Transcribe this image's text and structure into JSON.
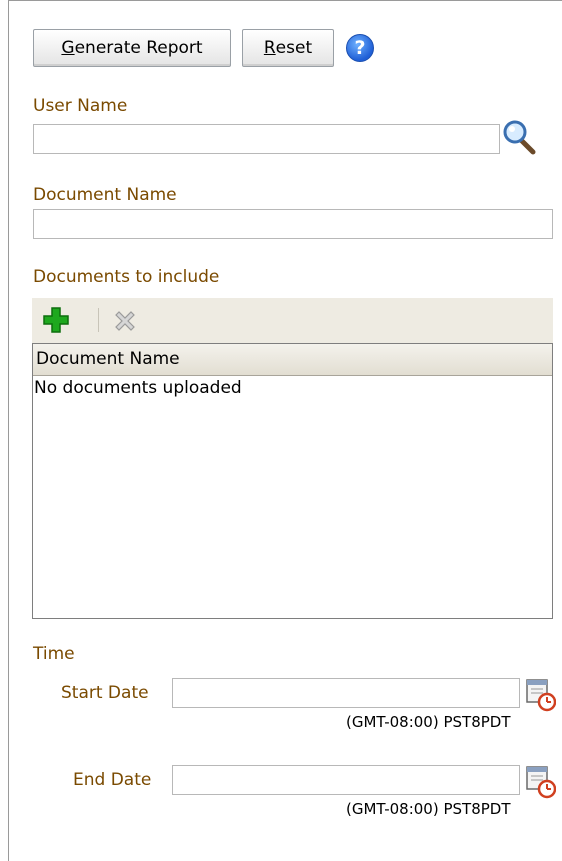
{
  "toolbar": {
    "generate_button_access": "G",
    "generate_button_rest": "enerate Report",
    "reset_button_access": "R",
    "reset_button_rest": "eset",
    "help_glyph": "?"
  },
  "fields": {
    "user_name_label": "User Name",
    "user_name_value": "",
    "document_name_label": "Document Name",
    "document_name_value": ""
  },
  "documents": {
    "section_label": "Documents to include",
    "add_icon": "add-icon",
    "remove_icon": "remove-icon",
    "column_header": "Document Name",
    "empty_text": "No documents uploaded"
  },
  "time": {
    "section_label": "Time",
    "start_label": "Start Date",
    "start_value": "",
    "start_timezone": "(GMT-08:00) PST8PDT",
    "end_label": "End Date",
    "end_value": "",
    "end_timezone": "(GMT-08:00) PST8PDT"
  },
  "colors": {
    "label": "#7a4a00",
    "help": "#1f5fd6",
    "add_green": "#1ea81e"
  }
}
